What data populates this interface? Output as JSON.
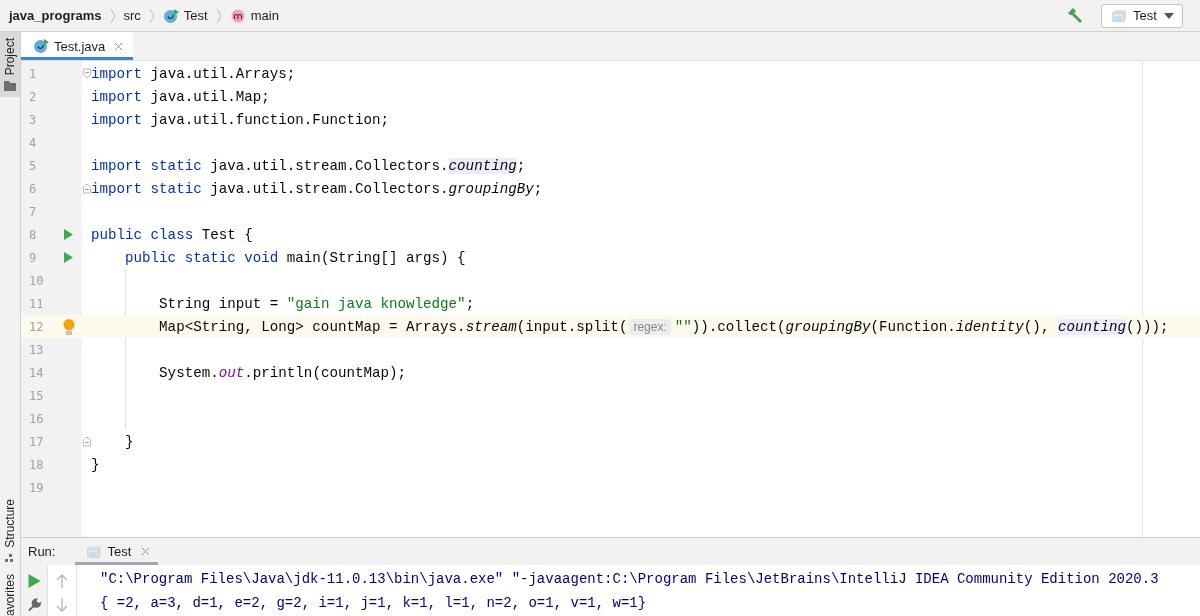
{
  "breadcrumbs": [
    {
      "label": "java_programs",
      "kind": "project"
    },
    {
      "label": "src",
      "kind": "folder"
    },
    {
      "label": "Test",
      "kind": "class"
    },
    {
      "label": "main",
      "kind": "method"
    }
  ],
  "run_config": {
    "label": "Test"
  },
  "left_stripe": {
    "top": [
      {
        "label": "Project",
        "selected": true
      }
    ],
    "bottom": [
      {
        "label": "Structure",
        "selected": false
      },
      {
        "label": "avorites",
        "selected": false
      }
    ]
  },
  "editor_tabs": [
    {
      "label": "Test.java",
      "selected": true
    }
  ],
  "code_lines": [
    {
      "number": "1",
      "fold_start": true,
      "current": false,
      "tokens": [
        {
          "text": "import",
          "kind": "keyword"
        },
        {
          "text": " java.util.Arrays;",
          "kind": "plain"
        }
      ]
    },
    {
      "number": "2",
      "current": false,
      "tokens": [
        {
          "text": "import",
          "kind": "keyword"
        },
        {
          "text": " java.util.Map;",
          "kind": "plain"
        }
      ]
    },
    {
      "number": "3",
      "current": false,
      "tokens": [
        {
          "text": "import",
          "kind": "keyword"
        },
        {
          "text": " java.util.function.Function;",
          "kind": "plain"
        }
      ]
    },
    {
      "number": "4",
      "current": false
    },
    {
      "number": "5",
      "current": false,
      "tokens": [
        {
          "text": "import static",
          "kind": "keyword"
        },
        {
          "text": " java.util.stream.Collectors.",
          "kind": "plain"
        },
        {
          "text": "counting",
          "kind": "highlighted"
        },
        {
          "text": ";",
          "kind": "plain"
        }
      ]
    },
    {
      "number": "6",
      "fold_end": true,
      "current": false,
      "tokens": [
        {
          "text": "import static",
          "kind": "keyword"
        },
        {
          "text": " java.util.stream.Collectors.",
          "kind": "plain"
        },
        {
          "text": "groupingBy",
          "kind": "italic"
        },
        {
          "text": ";",
          "kind": "plain"
        }
      ]
    },
    {
      "number": "7",
      "current": false
    },
    {
      "number": "8",
      "run_marker": true,
      "current": false,
      "tokens": [
        {
          "text": "public class",
          "kind": "keyword"
        },
        {
          "text": " Test {",
          "kind": "plain"
        }
      ]
    },
    {
      "number": "9",
      "run_marker": true,
      "current": false,
      "tokens": [
        {
          "text": "    public static void",
          "kind": "keyword"
        },
        {
          "text": " main(String[] args) {",
          "kind": "plain"
        }
      ]
    },
    {
      "number": "10",
      "current": false
    },
    {
      "number": "11",
      "current": false,
      "tokens": [
        {
          "text": "        String input = ",
          "kind": "plain"
        },
        {
          "text": "\"gain java knowledge\"",
          "kind": "string"
        },
        {
          "text": ";",
          "kind": "plain"
        }
      ]
    },
    {
      "number": "12",
      "intention_bulb": true,
      "current": true,
      "tokens": [
        {
          "text": "        Map<String, Long> countMap = Arrays.",
          "kind": "plain"
        },
        {
          "text": "stream",
          "kind": "italic"
        },
        {
          "text": "(input.split(",
          "kind": "plain"
        },
        {
          "text": "regex:",
          "kind": "hint"
        },
        {
          "text": "\"\"",
          "kind": "string"
        },
        {
          "text": ")).collect(",
          "kind": "plain"
        },
        {
          "text": "groupingBy",
          "kind": "italic"
        },
        {
          "text": "(Function.",
          "kind": "plain"
        },
        {
          "text": "identity",
          "kind": "italic"
        },
        {
          "text": "(), ",
          "kind": "plain"
        },
        {
          "text": "counting",
          "kind": "highlighted"
        },
        {
          "text": "()));",
          "kind": "plain"
        }
      ]
    },
    {
      "number": "13",
      "current": false
    },
    {
      "number": "14",
      "current": false,
      "tokens": [
        {
          "text": "        System.",
          "kind": "plain"
        },
        {
          "text": "out",
          "kind": "field"
        },
        {
          "text": ".println(countMap);",
          "kind": "plain"
        }
      ]
    },
    {
      "number": "15",
      "current": false
    },
    {
      "number": "16",
      "current": false
    },
    {
      "number": "17",
      "fold_end": true,
      "current": false,
      "tokens": [
        {
          "text": "    }",
          "kind": "plain"
        }
      ]
    },
    {
      "number": "18",
      "current": false,
      "tokens": [
        {
          "text": "}",
          "kind": "plain"
        }
      ]
    },
    {
      "number": "19",
      "current": false
    }
  ],
  "run_panel": {
    "title": "Run:",
    "tabs": [
      {
        "label": "Test",
        "selected": true
      }
    ],
    "output": [
      "\"C:\\Program Files\\Java\\jdk-11.0.13\\bin\\java.exe\" \"-javaagent:C:\\Program Files\\JetBrains\\IntelliJ IDEA Community Edition 2020.3",
      "{ =2, a=3, d=1, e=2, g=2, i=1, j=1, k=1, l=1, n=2, o=1, v=1, w=1}"
    ]
  }
}
